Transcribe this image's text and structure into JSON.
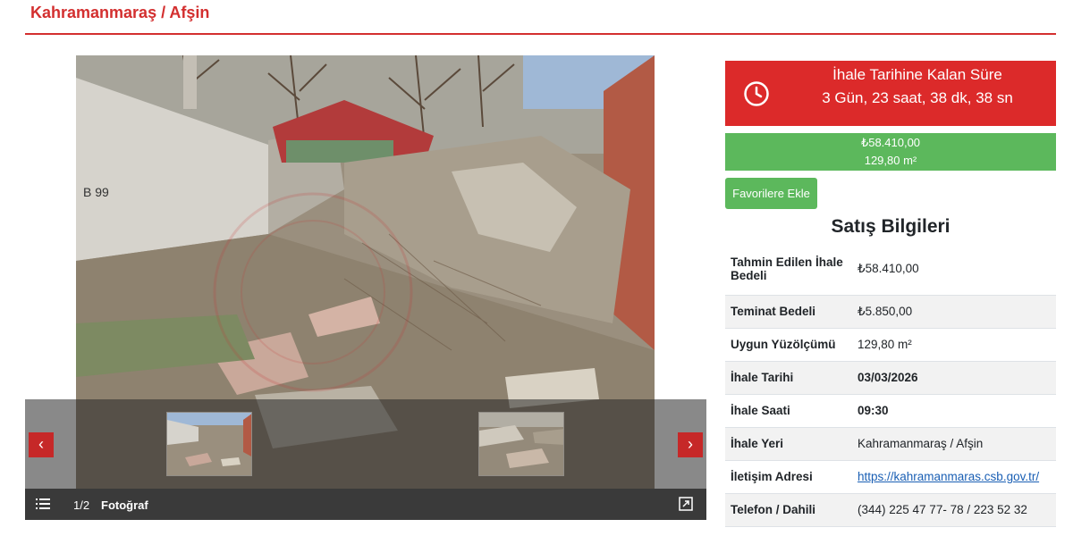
{
  "header": {
    "title": "Kahramanmaraş / Afşin"
  },
  "gallery": {
    "counter": "1/2",
    "label": "Fotoğraf",
    "prev_icon": "chevron-left-icon",
    "next_icon": "chevron-right-icon",
    "list_icon": "list-icon",
    "expand_icon": "expand-icon"
  },
  "countdown": {
    "title": "İhale Tarihine Kalan Süre",
    "value": "3 Gün, 23 saat, 38 dk, 38 sn",
    "icon": "clock-icon"
  },
  "price_box": {
    "price": "₺58.410,00",
    "area": "129,80 m²"
  },
  "favorites_button": "Favorilere Ekle",
  "section_title": "Satış Bilgileri",
  "info": {
    "rows": [
      {
        "label": "Tahmin Edilen İhale Bedeli",
        "value": "₺58.410,00"
      },
      {
        "label": "Teminat Bedeli",
        "value": "₺5.850,00"
      },
      {
        "label": "Uygun Yüzölçümü",
        "value": "129,80 m²"
      },
      {
        "label": "İhale Tarihi",
        "value": "03/03/2026"
      },
      {
        "label": "İhale Saati",
        "value": "09:30"
      },
      {
        "label": "İhale Yeri",
        "value": "Kahramanmaraş / Afşin"
      },
      {
        "label": "İletişim Adresi",
        "value": "https://kahramanmaras.csb.gov.tr/"
      },
      {
        "label": "Telefon / Dahili",
        "value": "(344) 225 47 77- 78 / 223 52 32"
      }
    ]
  },
  "colors": {
    "accent_red": "#dc2a2a",
    "success_green": "#5cb85c",
    "link_blue": "#1a5fb4"
  }
}
